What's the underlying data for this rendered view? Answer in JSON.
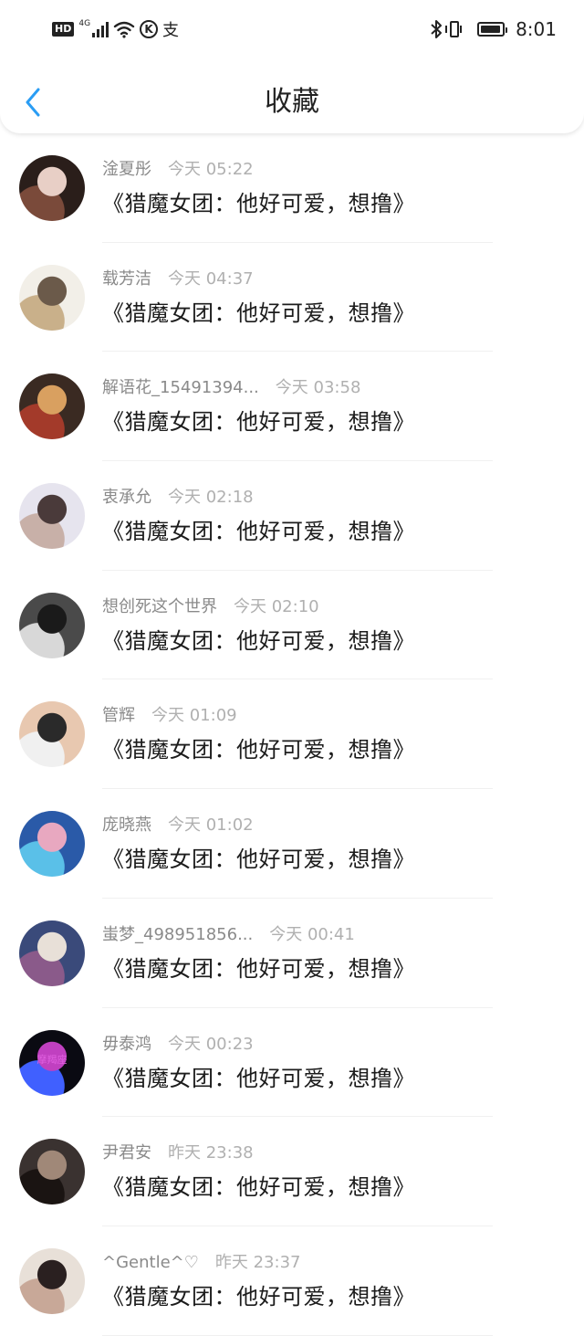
{
  "status_bar": {
    "hd": "HD",
    "network": "4G",
    "k_icon": "K",
    "pay_icon": "支",
    "time": "8:01"
  },
  "header": {
    "title": "收藏"
  },
  "items": [
    {
      "name": "淦夏彤",
      "time": "今天 05:22",
      "text": "《猎魔女团：他好可爱，想撸》",
      "avatar_colors": [
        "#2a1e1a",
        "#e8cfc6",
        "#7a4a3a"
      ]
    },
    {
      "name": "载芳洁",
      "time": "今天 04:37",
      "text": "《猎魔女团：他好可爱，想撸》",
      "avatar_colors": [
        "#f2efe8",
        "#6b5a4a",
        "#c9b08a"
      ]
    },
    {
      "name": "解语花_15491394...",
      "time": "今天 03:58",
      "text": "《猎魔女团：他好可爱，想撸》",
      "avatar_colors": [
        "#3a2a22",
        "#d9a060",
        "#a33a2a"
      ]
    },
    {
      "name": "衷承允",
      "time": "今天 02:18",
      "text": "《猎魔女团：他好可爱，想撸》",
      "avatar_colors": [
        "#e6e4ee",
        "#4a3a3a",
        "#c8b0a8"
      ]
    },
    {
      "name": "想创死这个世界",
      "time": "今天 02:10",
      "text": "《猎魔女团：他好可爱，想撸》",
      "avatar_colors": [
        "#4a4a4a",
        "#1a1a1a",
        "#d8d8d8"
      ]
    },
    {
      "name": "管辉",
      "time": "今天 01:09",
      "text": "《猎魔女团：他好可爱，想撸》",
      "avatar_colors": [
        "#e8c8b0",
        "#2a2a2a",
        "#f0f0f0"
      ]
    },
    {
      "name": "庞晓燕",
      "time": "今天 01:02",
      "text": "《猎魔女团：他好可爱，想撸》",
      "avatar_colors": [
        "#2a5aa8",
        "#e8a8c0",
        "#5ac0e8"
      ]
    },
    {
      "name": "蚩梦_498951856...",
      "time": "今天 00:41",
      "text": "《猎魔女团：他好可爱，想撸》",
      "avatar_colors": [
        "#3a4a7a",
        "#e8e0d8",
        "#8a5a8a"
      ]
    },
    {
      "name": "毋泰鸿",
      "time": "今天 00:23",
      "text": "《猎魔女团：他好可爱，想撸》",
      "avatar_colors": [
        "#0a0a12",
        "#c040c0",
        "#4060ff"
      ],
      "avatar_text": "摩羯座"
    },
    {
      "name": "尹君安",
      "time": "昨天 23:38",
      "text": "《猎魔女团：他好可爱，想撸》",
      "avatar_colors": [
        "#3a3230",
        "#a08878",
        "#1a1412"
      ]
    },
    {
      "name": "^Gentle^♡",
      "time": "昨天 23:37",
      "text": "《猎魔女团：他好可爱，想撸》",
      "avatar_colors": [
        "#e8e0d8",
        "#2a2020",
        "#c8a898"
      ]
    }
  ]
}
